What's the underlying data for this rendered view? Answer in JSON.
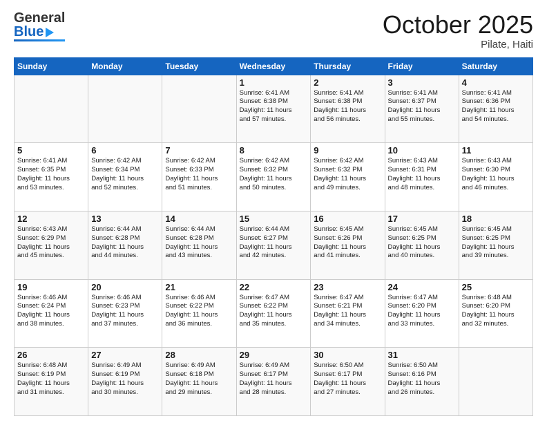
{
  "header": {
    "logo_general": "General",
    "logo_blue": "Blue",
    "month_title": "October 2025",
    "location": "Pilate, Haiti"
  },
  "days_of_week": [
    "Sunday",
    "Monday",
    "Tuesday",
    "Wednesday",
    "Thursday",
    "Friday",
    "Saturday"
  ],
  "weeks": [
    [
      {
        "day": "",
        "info": ""
      },
      {
        "day": "",
        "info": ""
      },
      {
        "day": "",
        "info": ""
      },
      {
        "day": "1",
        "info": "Sunrise: 6:41 AM\nSunset: 6:38 PM\nDaylight: 11 hours\nand 57 minutes."
      },
      {
        "day": "2",
        "info": "Sunrise: 6:41 AM\nSunset: 6:38 PM\nDaylight: 11 hours\nand 56 minutes."
      },
      {
        "day": "3",
        "info": "Sunrise: 6:41 AM\nSunset: 6:37 PM\nDaylight: 11 hours\nand 55 minutes."
      },
      {
        "day": "4",
        "info": "Sunrise: 6:41 AM\nSunset: 6:36 PM\nDaylight: 11 hours\nand 54 minutes."
      }
    ],
    [
      {
        "day": "5",
        "info": "Sunrise: 6:41 AM\nSunset: 6:35 PM\nDaylight: 11 hours\nand 53 minutes."
      },
      {
        "day": "6",
        "info": "Sunrise: 6:42 AM\nSunset: 6:34 PM\nDaylight: 11 hours\nand 52 minutes."
      },
      {
        "day": "7",
        "info": "Sunrise: 6:42 AM\nSunset: 6:33 PM\nDaylight: 11 hours\nand 51 minutes."
      },
      {
        "day": "8",
        "info": "Sunrise: 6:42 AM\nSunset: 6:32 PM\nDaylight: 11 hours\nand 50 minutes."
      },
      {
        "day": "9",
        "info": "Sunrise: 6:42 AM\nSunset: 6:32 PM\nDaylight: 11 hours\nand 49 minutes."
      },
      {
        "day": "10",
        "info": "Sunrise: 6:43 AM\nSunset: 6:31 PM\nDaylight: 11 hours\nand 48 minutes."
      },
      {
        "day": "11",
        "info": "Sunrise: 6:43 AM\nSunset: 6:30 PM\nDaylight: 11 hours\nand 46 minutes."
      }
    ],
    [
      {
        "day": "12",
        "info": "Sunrise: 6:43 AM\nSunset: 6:29 PM\nDaylight: 11 hours\nand 45 minutes."
      },
      {
        "day": "13",
        "info": "Sunrise: 6:44 AM\nSunset: 6:28 PM\nDaylight: 11 hours\nand 44 minutes."
      },
      {
        "day": "14",
        "info": "Sunrise: 6:44 AM\nSunset: 6:28 PM\nDaylight: 11 hours\nand 43 minutes."
      },
      {
        "day": "15",
        "info": "Sunrise: 6:44 AM\nSunset: 6:27 PM\nDaylight: 11 hours\nand 42 minutes."
      },
      {
        "day": "16",
        "info": "Sunrise: 6:45 AM\nSunset: 6:26 PM\nDaylight: 11 hours\nand 41 minutes."
      },
      {
        "day": "17",
        "info": "Sunrise: 6:45 AM\nSunset: 6:25 PM\nDaylight: 11 hours\nand 40 minutes."
      },
      {
        "day": "18",
        "info": "Sunrise: 6:45 AM\nSunset: 6:25 PM\nDaylight: 11 hours\nand 39 minutes."
      }
    ],
    [
      {
        "day": "19",
        "info": "Sunrise: 6:46 AM\nSunset: 6:24 PM\nDaylight: 11 hours\nand 38 minutes."
      },
      {
        "day": "20",
        "info": "Sunrise: 6:46 AM\nSunset: 6:23 PM\nDaylight: 11 hours\nand 37 minutes."
      },
      {
        "day": "21",
        "info": "Sunrise: 6:46 AM\nSunset: 6:22 PM\nDaylight: 11 hours\nand 36 minutes."
      },
      {
        "day": "22",
        "info": "Sunrise: 6:47 AM\nSunset: 6:22 PM\nDaylight: 11 hours\nand 35 minutes."
      },
      {
        "day": "23",
        "info": "Sunrise: 6:47 AM\nSunset: 6:21 PM\nDaylight: 11 hours\nand 34 minutes."
      },
      {
        "day": "24",
        "info": "Sunrise: 6:47 AM\nSunset: 6:20 PM\nDaylight: 11 hours\nand 33 minutes."
      },
      {
        "day": "25",
        "info": "Sunrise: 6:48 AM\nSunset: 6:20 PM\nDaylight: 11 hours\nand 32 minutes."
      }
    ],
    [
      {
        "day": "26",
        "info": "Sunrise: 6:48 AM\nSunset: 6:19 PM\nDaylight: 11 hours\nand 31 minutes."
      },
      {
        "day": "27",
        "info": "Sunrise: 6:49 AM\nSunset: 6:19 PM\nDaylight: 11 hours\nand 30 minutes."
      },
      {
        "day": "28",
        "info": "Sunrise: 6:49 AM\nSunset: 6:18 PM\nDaylight: 11 hours\nand 29 minutes."
      },
      {
        "day": "29",
        "info": "Sunrise: 6:49 AM\nSunset: 6:17 PM\nDaylight: 11 hours\nand 28 minutes."
      },
      {
        "day": "30",
        "info": "Sunrise: 6:50 AM\nSunset: 6:17 PM\nDaylight: 11 hours\nand 27 minutes."
      },
      {
        "day": "31",
        "info": "Sunrise: 6:50 AM\nSunset: 6:16 PM\nDaylight: 11 hours\nand 26 minutes."
      },
      {
        "day": "",
        "info": ""
      }
    ]
  ]
}
